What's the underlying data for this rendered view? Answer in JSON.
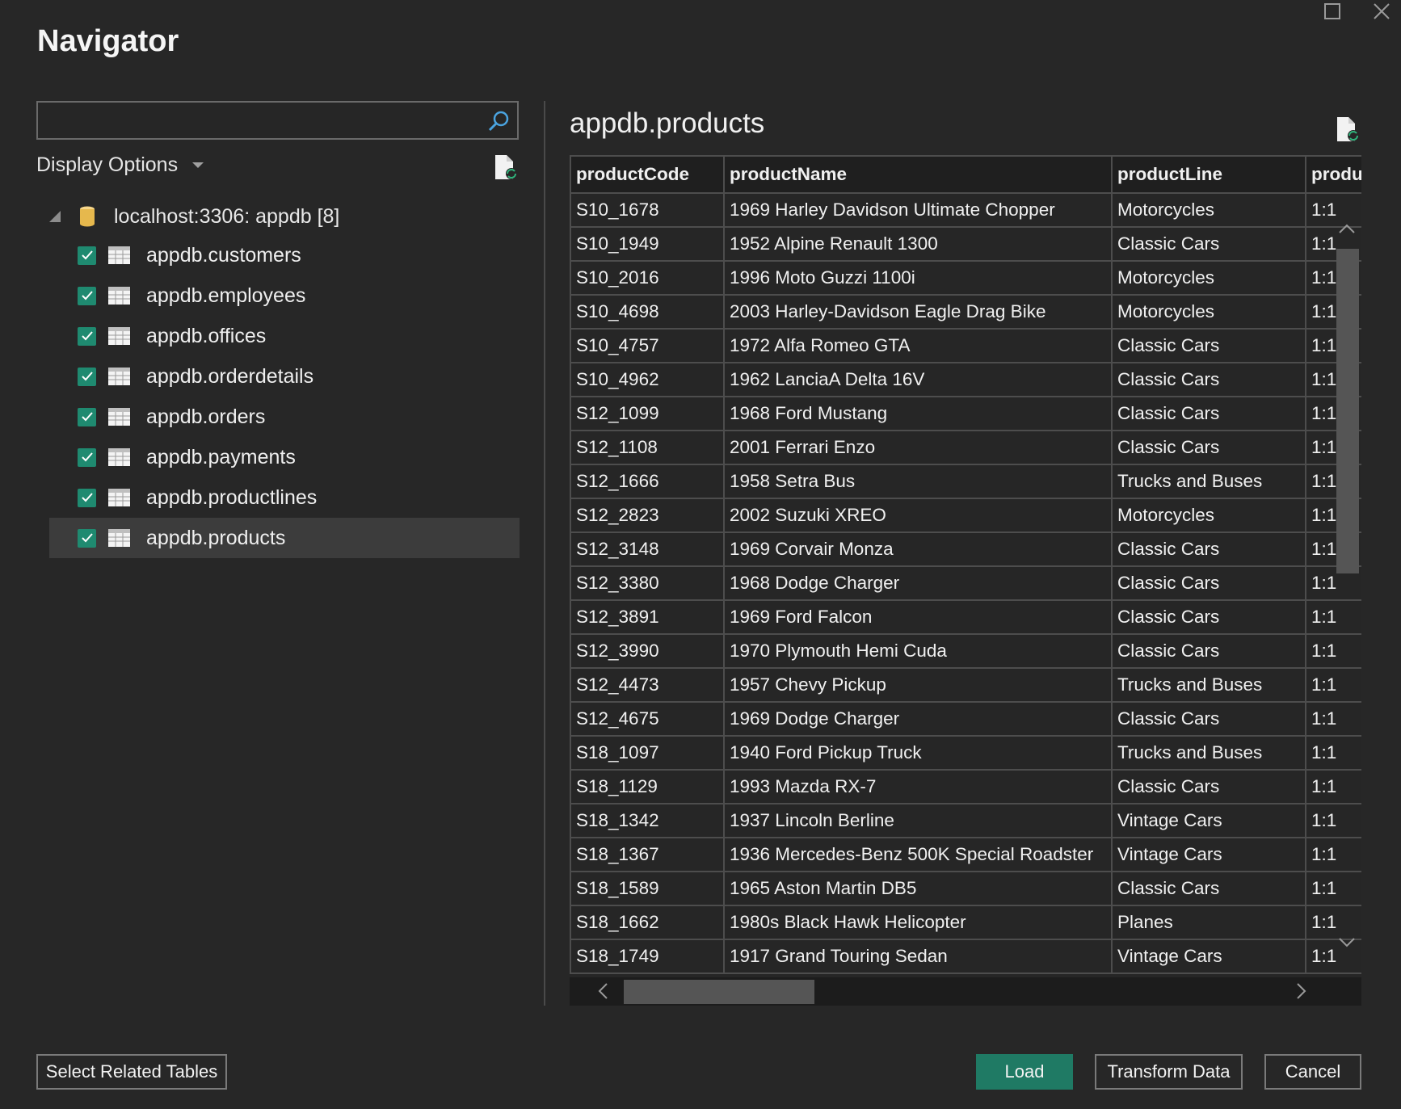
{
  "window": {
    "title": "Navigator",
    "maximize_icon": "maximize-icon",
    "close_icon": "close-icon"
  },
  "search": {
    "value": "",
    "placeholder": ""
  },
  "display_options": {
    "label": "Display Options"
  },
  "tree": {
    "root": {
      "label": "localhost:3306: appdb [8]"
    },
    "items": [
      {
        "label": "appdb.customers",
        "checked": true
      },
      {
        "label": "appdb.employees",
        "checked": true
      },
      {
        "label": "appdb.offices",
        "checked": true
      },
      {
        "label": "appdb.orderdetails",
        "checked": true
      },
      {
        "label": "appdb.orders",
        "checked": true
      },
      {
        "label": "appdb.payments",
        "checked": true
      },
      {
        "label": "appdb.productlines",
        "checked": true
      },
      {
        "label": "appdb.products",
        "checked": true,
        "selected": true
      }
    ]
  },
  "preview": {
    "title": "appdb.products",
    "columns": [
      "productCode",
      "productName",
      "productLine",
      "produ"
    ],
    "rows": [
      [
        "S10_1678",
        "1969 Harley Davidson Ultimate Chopper",
        "Motorcycles",
        "1:1"
      ],
      [
        "S10_1949",
        "1952 Alpine Renault 1300",
        "Classic Cars",
        "1:1"
      ],
      [
        "S10_2016",
        "1996 Moto Guzzi 1100i",
        "Motorcycles",
        "1:1"
      ],
      [
        "S10_4698",
        "2003 Harley-Davidson Eagle Drag Bike",
        "Motorcycles",
        "1:1"
      ],
      [
        "S10_4757",
        "1972 Alfa Romeo GTA",
        "Classic Cars",
        "1:1"
      ],
      [
        "S10_4962",
        "1962 LanciaA Delta 16V",
        "Classic Cars",
        "1:1"
      ],
      [
        "S12_1099",
        "1968 Ford Mustang",
        "Classic Cars",
        "1:1"
      ],
      [
        "S12_1108",
        "2001 Ferrari Enzo",
        "Classic Cars",
        "1:1"
      ],
      [
        "S12_1666",
        "1958 Setra Bus",
        "Trucks and Buses",
        "1:1"
      ],
      [
        "S12_2823",
        "2002 Suzuki XREO",
        "Motorcycles",
        "1:1"
      ],
      [
        "S12_3148",
        "1969 Corvair Monza",
        "Classic Cars",
        "1:1"
      ],
      [
        "S12_3380",
        "1968 Dodge Charger",
        "Classic Cars",
        "1:1"
      ],
      [
        "S12_3891",
        "1969 Ford Falcon",
        "Classic Cars",
        "1:1"
      ],
      [
        "S12_3990",
        "1970 Plymouth Hemi Cuda",
        "Classic Cars",
        "1:1"
      ],
      [
        "S12_4473",
        "1957 Chevy Pickup",
        "Trucks and Buses",
        "1:1"
      ],
      [
        "S12_4675",
        "1969 Dodge Charger",
        "Classic Cars",
        "1:1"
      ],
      [
        "S18_1097",
        "1940 Ford Pickup Truck",
        "Trucks and Buses",
        "1:1"
      ],
      [
        "S18_1129",
        "1993 Mazda RX-7",
        "Classic Cars",
        "1:1"
      ],
      [
        "S18_1342",
        "1937 Lincoln Berline",
        "Vintage Cars",
        "1:1"
      ],
      [
        "S18_1367",
        "1936 Mercedes-Benz 500K Special Roadster",
        "Vintage Cars",
        "1:1"
      ],
      [
        "S18_1589",
        "1965 Aston Martin DB5",
        "Classic Cars",
        "1:1"
      ],
      [
        "S18_1662",
        "1980s Black Hawk Helicopter",
        "Planes",
        "1:1"
      ],
      [
        "S18_1749",
        "1917 Grand Touring Sedan",
        "Vintage Cars",
        "1:1"
      ]
    ]
  },
  "footer": {
    "select_related": "Select Related Tables",
    "load": "Load",
    "transform": "Transform Data",
    "cancel": "Cancel"
  },
  "colors": {
    "background": "#272727",
    "accent": "#1f7a64",
    "checkbox": "#1f8a70",
    "selected_row": "#3c3c3c"
  }
}
